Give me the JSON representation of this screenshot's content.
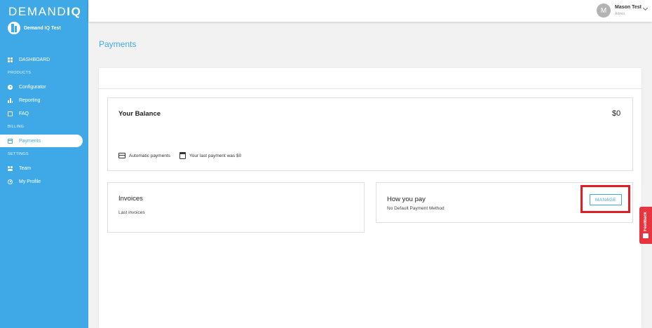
{
  "brand": {
    "logo_regular": "DEMAND",
    "logo_bold": "IQ",
    "company": "Demand IQ Test"
  },
  "sidebar": {
    "items": [
      {
        "label": "DASHBOARD",
        "icon": "grid-icon"
      },
      {
        "section": "PRODUCTS"
      },
      {
        "label": "Configurator",
        "icon": "gear-icon"
      },
      {
        "label": "Reporting",
        "icon": "bar-chart-icon"
      },
      {
        "label": "FAQ",
        "icon": "book-icon"
      },
      {
        "section": "BILLING"
      },
      {
        "label": "Payments",
        "icon": "credit-card-icon",
        "active": true
      },
      {
        "section": "SETTINGS"
      },
      {
        "label": "Team",
        "icon": "team-icon"
      },
      {
        "label": "My Profile",
        "icon": "user-circle-icon"
      }
    ]
  },
  "user": {
    "initial": "M",
    "name": "Mason Test",
    "role": "Admin"
  },
  "page": {
    "title": "Payments"
  },
  "balance": {
    "title": "Your Balance",
    "amount": "$0",
    "automatic_label": "Automatic payments",
    "last_payment": "Your last payment was $0"
  },
  "invoices": {
    "title": "Invoices",
    "subtitle": "Last invoices"
  },
  "how_you_pay": {
    "title": "How you pay",
    "subtitle": "No Default Payment Method",
    "manage_label": "MANAGE"
  },
  "feedback": {
    "label": "Feedback"
  },
  "colors": {
    "accent": "#3fa9e7",
    "highlight": "#e11d26",
    "feedback": "#e8343e"
  }
}
